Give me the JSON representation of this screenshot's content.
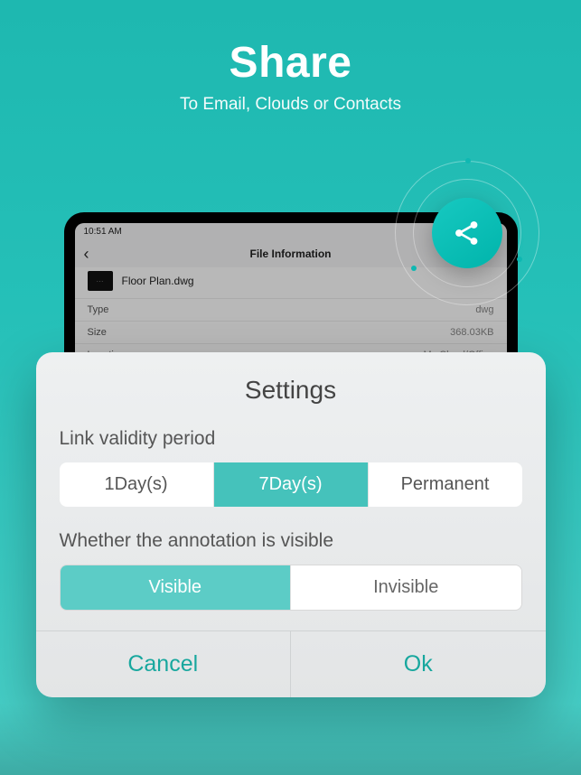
{
  "hero": {
    "title": "Share",
    "subtitle": "To Email, Clouds or Contacts"
  },
  "status_bar": {
    "time": "10:51 AM"
  },
  "nav": {
    "title": "File Information"
  },
  "file": {
    "name": "Floor Plan.dwg"
  },
  "info": {
    "type_label": "Type",
    "type_value": "dwg",
    "size_label": "Size",
    "size_value": "368.03KB",
    "location_label": "Location",
    "location_value": "My Cloud/Office"
  },
  "share_icon_name": "share-icon",
  "modal": {
    "title": "Settings",
    "validity_label": "Link validity period",
    "validity_options": {
      "one": "1Day(s)",
      "seven": "7Day(s)",
      "perm": "Permanent"
    },
    "visibility_label": "Whether the annotation is visible",
    "visibility_options": {
      "visible": "Visible",
      "invisible": "Invisible"
    },
    "cancel": "Cancel",
    "ok": "Ok"
  }
}
